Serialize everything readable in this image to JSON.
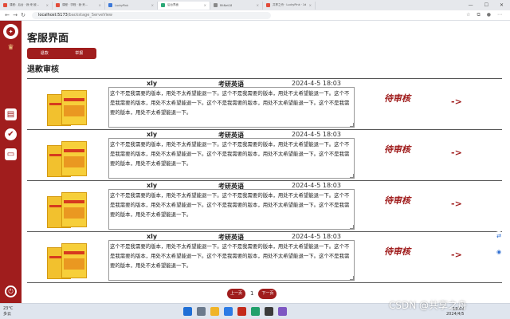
{
  "browser": {
    "tabs": [
      {
        "label": "课程：后台 · 我·来·被…",
        "color": "#e24c3a"
      },
      {
        "label": "课程 · 学程 · 我·来…",
        "color": "#e24c3a"
      },
      {
        "label": "LuckyPink",
        "color": "#3c78d8"
      },
      {
        "label": "后台界面",
        "color": "#2aa876",
        "active": true
      },
      {
        "label": "RitNet18",
        "color": "#888888"
      },
      {
        "label": "共享之舟 · LuckyPink · 1dilCode",
        "color": "#e24c3a"
      }
    ],
    "url_host": "localhost:5173",
    "url_path": "/backstage_ServeView"
  },
  "page": {
    "title": "客服界面",
    "seg_refund": "退款",
    "seg_report": "举报",
    "section_title": "退款审核",
    "accent": "#a01d1d"
  },
  "rows": [
    {
      "user": "xly",
      "subject": "考研英语",
      "date": "2024-4-5 18:03",
      "text": "这个不是我需要的版本，用处不太希望能退一下。这个不是我需要的版本，用处不太希望能退一下。这个不是我需要的版本，用处不太希望能退一下。这个不是我需要的版本，用处不太希望能退一下。这个不是我需要的版本，用处不太希望能退一下。",
      "status": "待审核",
      "arrow": "->"
    },
    {
      "user": "xly",
      "subject": "考研英语",
      "date": "2024-4-5 18:03",
      "text": "这个不是我需要的版本，用处不太希望能退一下。这个不是我需要的版本，用处不太希望能退一下。这个不是我需要的版本，用处不太希望能退一下。这个不是我需要的版本，用处不太希望能退一下。这个不是我需要的版本，用处不太希望能退一下。",
      "status": "待审核",
      "arrow": "->"
    },
    {
      "user": "xly",
      "subject": "考研英语",
      "date": "2024-4-5 18:03",
      "text": "这个不是我需要的版本，用处不太希望能退一下。这个不是我需要的版本，用处不太希望能退一下。这个不是我需要的版本，用处不太希望能退一下。这个不是我需要的版本，用处不太希望能退一下。这个不是我需要的版本，用处不太希望能退一下。",
      "status": "待审核",
      "arrow": "->"
    },
    {
      "user": "xly",
      "subject": "考研英语",
      "date": "2024-4-5 18:03",
      "text": "这个不是我需要的版本，用处不太希望能退一下。这个不是我需要的版本，用处不太希望能退一下。这个不是我需要的版本，用处不太希望能退一下。这个不是我需要的版本，用处不太希望能退一下。这个不是我需要的版本，用处不太希望能退一下。",
      "status": "待审核",
      "arrow": "->"
    }
  ],
  "pager": {
    "prev": "上一页",
    "page": "1",
    "next": "下一页"
  },
  "taskbar": {
    "temp": "23°C",
    "weather": "多云",
    "time": "18:03",
    "date": "2024/4/5"
  },
  "watermark": "CSDN @共享之舟"
}
